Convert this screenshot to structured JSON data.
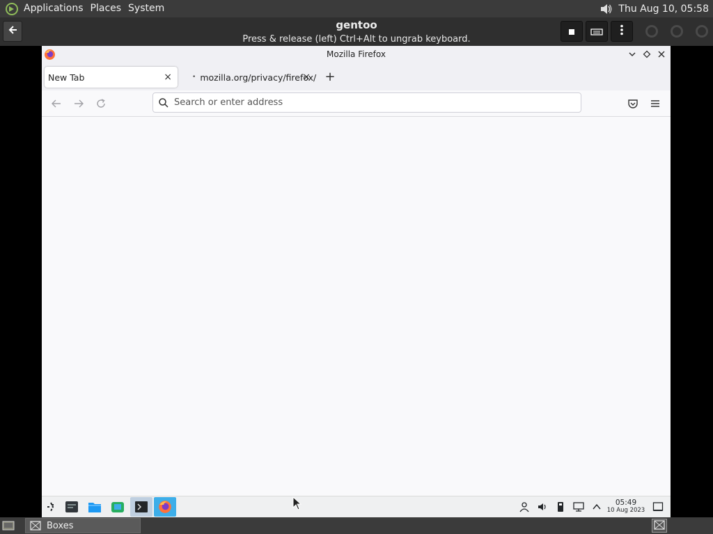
{
  "host_top_panel": {
    "menus": [
      "Applications",
      "Places",
      "System"
    ],
    "clock": "Thu Aug 10, 05:58",
    "icons": [
      "mate-menu-icon",
      "volume-icon"
    ]
  },
  "boxes_header": {
    "title": "gentoo",
    "subtitle": "Press & release (left) Ctrl+Alt to ungrab keyboard.",
    "icons": [
      "back-arrow-icon",
      "stop-icon",
      "keyboard-icon",
      "kebab-menu-icon"
    ]
  },
  "firefox": {
    "window_title": "Mozilla Firefox",
    "tabs": [
      {
        "label": "New Tab",
        "active": true
      },
      {
        "label": "mozilla.org/privacy/firefox/",
        "active": false
      }
    ],
    "new_tab_glyph": "+",
    "close_glyph": "×",
    "urlbar": {
      "placeholder": "Search or enter address",
      "value": ""
    },
    "titlebar_controls": [
      "minimize",
      "maximize",
      "close"
    ],
    "nav_icons": [
      "back-arrow-icon",
      "forward-arrow-icon",
      "reload-icon",
      "pocket-icon",
      "hamburger-menu-icon"
    ]
  },
  "guest_taskbar": {
    "clock_time": "05:49",
    "clock_date": "10 Aug 2023",
    "launchers": [
      "app-launcher-icon",
      "terminal-icon",
      "file-manager-icon",
      "software-center-icon",
      "konsole-icon",
      "firefox-icon"
    ],
    "tray": [
      "user-icon",
      "volume-icon",
      "usb-device-icon",
      "network-icon",
      "expand-tray-icon",
      "show-desktop-icon"
    ]
  },
  "host_bottom_panel": {
    "task_label": "Boxes"
  },
  "colors": {
    "host_panel": "#3b3b3b",
    "boxes_header": "#2f2f2f",
    "firefox_chrome": "#f0f0f4",
    "guest_taskbar": "#eff0f1",
    "accent": "#3daee9"
  }
}
